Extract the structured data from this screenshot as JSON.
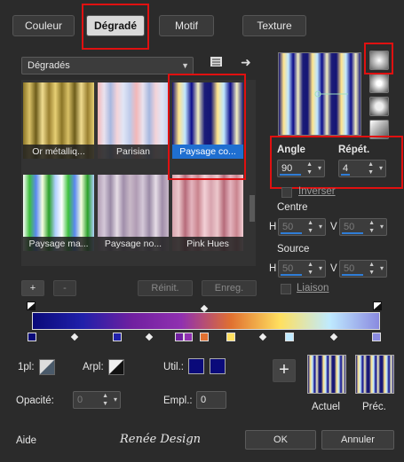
{
  "tabs": [
    {
      "label": "Couleur",
      "active": false
    },
    {
      "label": "Dégradé",
      "active": true
    },
    {
      "label": "Motif",
      "active": false
    },
    {
      "label": "Texture",
      "active": false
    }
  ],
  "library": {
    "selected": "Dégradés"
  },
  "gallery": [
    {
      "label": "Or métalliq...",
      "colors": [
        "#8a7426",
        "#d8c067",
        "#6d5c1a",
        "#f0dc90",
        "#9a8030",
        "#e6cf74"
      ]
    },
    {
      "label": "Parisian",
      "colors": [
        "#f3b7b8",
        "#e9e2ee",
        "#a7b8e0",
        "#f4d3d8",
        "#dfe5f6",
        "#bfcbea"
      ]
    },
    {
      "label": "Paysage co...",
      "colors": [
        "#151575",
        "#ffe48c",
        "#bfe6ff",
        "#0a0a8a",
        "#f4f0c0",
        "#1b1b78"
      ],
      "selected": true
    },
    {
      "label": "Paysage ma...",
      "colors": [
        "#ffffff",
        "#3ec13e",
        "#5b89f0",
        "#f8ffe0",
        "#2aa02a",
        "#b0d0ff"
      ]
    },
    {
      "label": "Paysage no...",
      "colors": [
        "#b09cb4",
        "#d4c8d8",
        "#9a8aa6",
        "#e6dde6",
        "#a08eaa",
        "#c8b8c8"
      ]
    },
    {
      "label": "Pink Hues",
      "colors": [
        "#d8a4ae",
        "#ecc8cc",
        "#b66b7a",
        "#e4b4be",
        "#c9848e",
        "#f2d0d6"
      ]
    }
  ],
  "toolbar_bottom": {
    "add": "+",
    "remove": "-",
    "reinit": "Réinit.",
    "enreg": "Enreg."
  },
  "angle": {
    "label": "Angle",
    "value": "90"
  },
  "repet": {
    "label": "Répét.",
    "value": "4"
  },
  "inverse": {
    "label": "Inverser"
  },
  "centre": {
    "label": "Centre",
    "h_label": "H",
    "h_value": "50",
    "v_label": "V",
    "v_value": "50"
  },
  "source": {
    "label": "Source",
    "h_label": "H",
    "h_value": "50",
    "v_label": "V",
    "v_value": "50"
  },
  "liaison": {
    "label": "Liaison"
  },
  "gradient_stops": [
    "#0a0a7a",
    "#2020aa",
    "#7020a0",
    "#9030b0",
    "#e07030",
    "#ffe060",
    "#bfeaff",
    "#8a8ae0"
  ],
  "controls": {
    "lpl_label": "1pl:",
    "arpl_label": "Arpl:",
    "util_label": "Util.:",
    "opacite_label": "Opacité:",
    "opacite_value": "0",
    "empl_label": "Empl.:",
    "empl_value": "0"
  },
  "swatches": {
    "actuel": "Actuel",
    "prec": "Préc."
  },
  "footer": {
    "aide": "Aide",
    "logo": "Renée Design",
    "ok": "OK",
    "annuler": "Annuler"
  }
}
